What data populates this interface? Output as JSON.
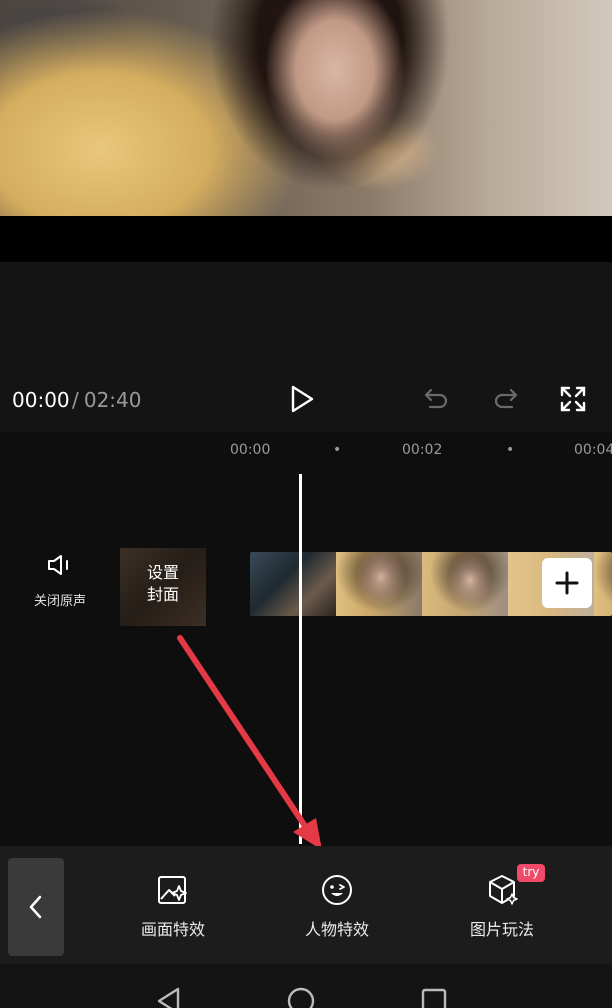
{
  "playback": {
    "current_time": "00:00",
    "separator": "/",
    "total_time": "02:40"
  },
  "ruler": {
    "marks": [
      "00:00",
      "00:02",
      "00:04"
    ]
  },
  "timeline": {
    "audio_toggle_label": "关闭原声",
    "cover_label_line1": "设置",
    "cover_label_line2": "封面"
  },
  "toolbar": {
    "items": [
      {
        "label": "画面特效",
        "icon": "image-effect-icon"
      },
      {
        "label": "人物特效",
        "icon": "face-effect-icon"
      },
      {
        "label": "图片玩法",
        "icon": "cube-sparkle-icon"
      }
    ],
    "badge": "try"
  },
  "colors": {
    "background": "#141414",
    "timeline_background": "#0e0e0e",
    "toolbar_background": "#1c1c1c",
    "badge": "#f04a6a",
    "annotation_arrow": "#e53946"
  }
}
